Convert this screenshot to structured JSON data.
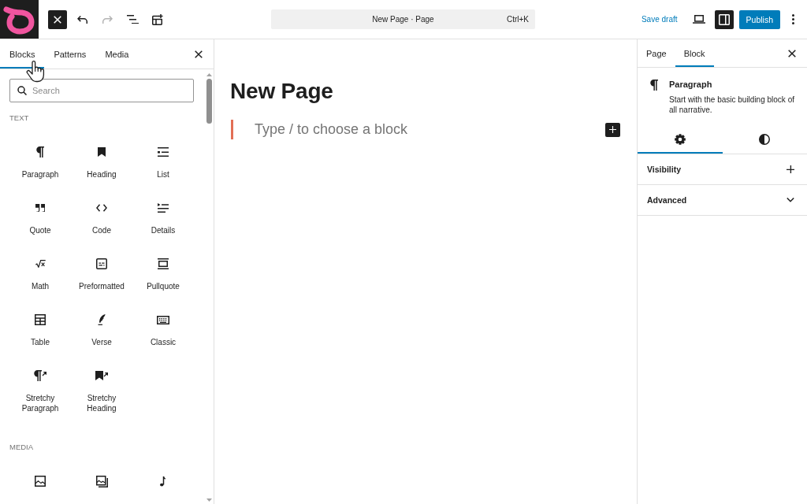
{
  "top_bar": {
    "inserter_toggle": {
      "on": true
    },
    "tools": [
      {
        "kind": "undo",
        "disabled": false
      },
      {
        "kind": "redo",
        "disabled": true
      },
      {
        "kind": "list-view",
        "disabled": false
      },
      {
        "kind": "template",
        "disabled": false
      }
    ],
    "command_bar": {
      "title": "New Page · Page",
      "shortcut": "Ctrl+K"
    },
    "save_draft": "Save draft",
    "settings_toggle": {
      "on": true
    },
    "publish": "Publish"
  },
  "inserter": {
    "tabs": [
      {
        "label": "Blocks",
        "selected": true
      },
      {
        "label": "Patterns",
        "selected": false
      },
      {
        "label": "Media",
        "selected": false
      }
    ],
    "search": {
      "placeholder": "Search"
    },
    "sections": [
      {
        "title": "TEXT",
        "blocks": [
          {
            "kind": "paragraph",
            "label": "Paragraph"
          },
          {
            "kind": "heading",
            "label": "Heading"
          },
          {
            "kind": "list",
            "label": "List"
          },
          {
            "kind": "quote",
            "label": "Quote"
          },
          {
            "kind": "code",
            "label": "Code"
          },
          {
            "kind": "details",
            "label": "Details"
          },
          {
            "kind": "math",
            "label": "Math"
          },
          {
            "kind": "preformatted",
            "label": "Preformatted"
          },
          {
            "kind": "pullquote",
            "label": "Pullquote"
          },
          {
            "kind": "table",
            "label": "Table"
          },
          {
            "kind": "verse",
            "label": "Verse"
          },
          {
            "kind": "classic",
            "label": "Classic"
          },
          {
            "kind": "stretchy-paragraph",
            "label": "Stretchy Paragraph"
          },
          {
            "kind": "stretchy-heading",
            "label": "Stretchy Heading"
          }
        ]
      },
      {
        "title": "MEDIA",
        "blocks": [
          {
            "kind": "image"
          },
          {
            "kind": "gallery"
          },
          {
            "kind": "audio"
          }
        ]
      }
    ]
  },
  "editor": {
    "title": "New Page",
    "placeholder": "Type / to choose a block"
  },
  "settings": {
    "tabs": [
      {
        "label": "Page",
        "selected": false
      },
      {
        "label": "Block",
        "selected": true
      }
    ],
    "block_card": {
      "kind": "paragraph",
      "title": "Paragraph",
      "description": "Start with the basic building block of all narrative."
    },
    "subtabs": [
      {
        "kind": "settings",
        "selected": true
      },
      {
        "kind": "styles",
        "selected": false
      }
    ],
    "panels": [
      {
        "kind": "tools",
        "title": "Visibility"
      },
      {
        "kind": "collapsible",
        "title": "Advanced",
        "expanded": false
      }
    ]
  }
}
